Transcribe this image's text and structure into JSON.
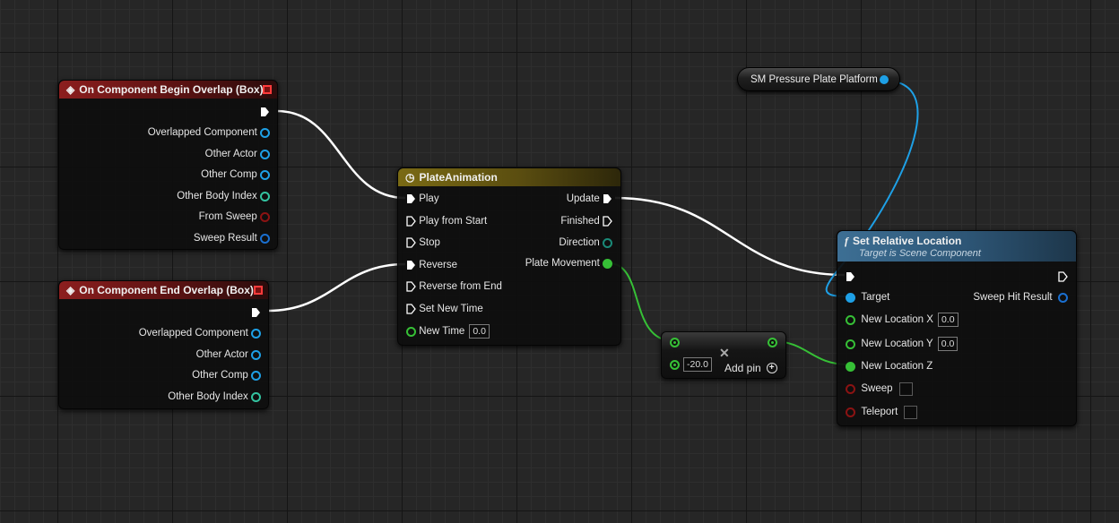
{
  "colors": {
    "object_pin": "#1ea0e6",
    "struct_pin": "#1a6fd0",
    "float_pin": "#36c036",
    "bool_pin": "#8b1313",
    "vector_pin": "#33c3a0",
    "exec_wire": "#ffffff"
  },
  "begin_overlap": {
    "title": "On Component Begin Overlap (Box)",
    "outputs": [
      "Overlapped Component",
      "Other Actor",
      "Other Comp",
      "Other Body Index",
      "From Sweep",
      "Sweep Result"
    ]
  },
  "end_overlap": {
    "title": "On Component End Overlap (Box)",
    "outputs": [
      "Overlapped Component",
      "Other Actor",
      "Other Comp",
      "Other Body Index"
    ]
  },
  "timeline": {
    "title": "PlateAnimation",
    "inputs": [
      "Play",
      "Play from Start",
      "Stop",
      "Reverse",
      "Reverse from End",
      "Set New Time"
    ],
    "new_time_label": "New Time",
    "new_time_value": "0.0",
    "outputs": [
      "Update",
      "Finished",
      "Direction",
      "Plate Movement"
    ]
  },
  "add_node": {
    "value": "-20.0",
    "add_pin_label": "Add pin"
  },
  "variable": {
    "label": "SM Pressure Plate Platform"
  },
  "set_location": {
    "title": "Set Relative Location",
    "subtitle": "Target is Scene Component",
    "target_label": "Target",
    "sweep_hit_label": "Sweep Hit Result",
    "x_label": "New Location X",
    "x_value": "0.0",
    "y_label": "New Location Y",
    "y_value": "0.0",
    "z_label": "New Location Z",
    "sweep_label": "Sweep",
    "teleport_label": "Teleport"
  }
}
